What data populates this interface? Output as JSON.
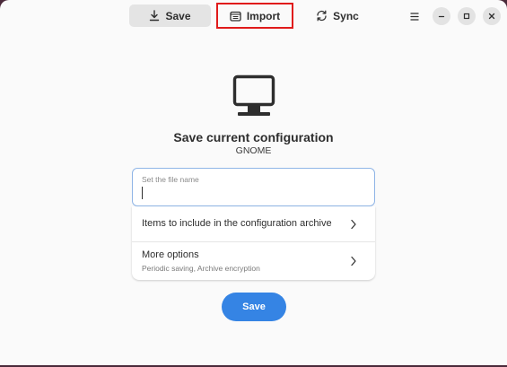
{
  "header": {
    "tabs": [
      {
        "label": "Save",
        "icon": "download-icon",
        "active": true
      },
      {
        "label": "Import",
        "icon": "import-icon",
        "active": false
      },
      {
        "label": "Sync",
        "icon": "sync-icon",
        "active": false
      }
    ]
  },
  "main": {
    "icon": "computer-monitor-icon",
    "title": "Save current configuration",
    "subtitle": "GNOME",
    "file_name_entry": {
      "label": "Set the file name",
      "value": ""
    },
    "rows": [
      {
        "title": "Items to include in the configuration archive"
      },
      {
        "title": "More options",
        "subtitle": "Periodic saving, Archive encryption"
      }
    ],
    "save_button_label": "Save"
  },
  "colors": {
    "accent": "#3584e4",
    "highlight": "#e01b1b",
    "window_bg": "#fafafa"
  }
}
